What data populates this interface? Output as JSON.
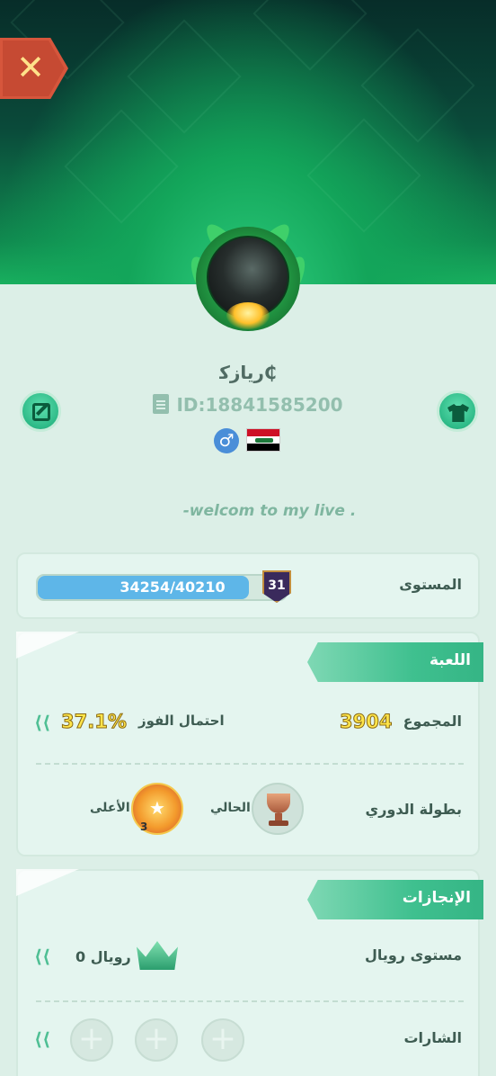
{
  "header": {
    "close_label": "✕"
  },
  "profile": {
    "name": "ريازﻛ₵",
    "id_text": "ID:18841585200",
    "gender_symbol": "♂",
    "bio": "-welcom to my live ."
  },
  "level": {
    "label": "المستوى",
    "progress_text": "34254/40210",
    "progress_current": 34254,
    "progress_max": 40210,
    "level_number": "31"
  },
  "game": {
    "title": "اللعبة",
    "total_label": "المجموع",
    "total_value": "3904",
    "win_rate_label": "احتمال الفوز",
    "win_rate_value": "37.1%",
    "league_label": "بطولة الدوري",
    "current_label": "الحالي",
    "highest_label": "الأعلى",
    "highest_rank_sub": "3"
  },
  "achievements": {
    "title": "الإنجازات",
    "royal_level_label": "مستوى رويال",
    "royal_value": "رويال 0",
    "badges_label": "الشارات"
  },
  "colors": {
    "accent": "#3fc08f",
    "progress": "#5eb6e8",
    "close": "#d6563c",
    "yellow_text": "#ffe54a"
  }
}
